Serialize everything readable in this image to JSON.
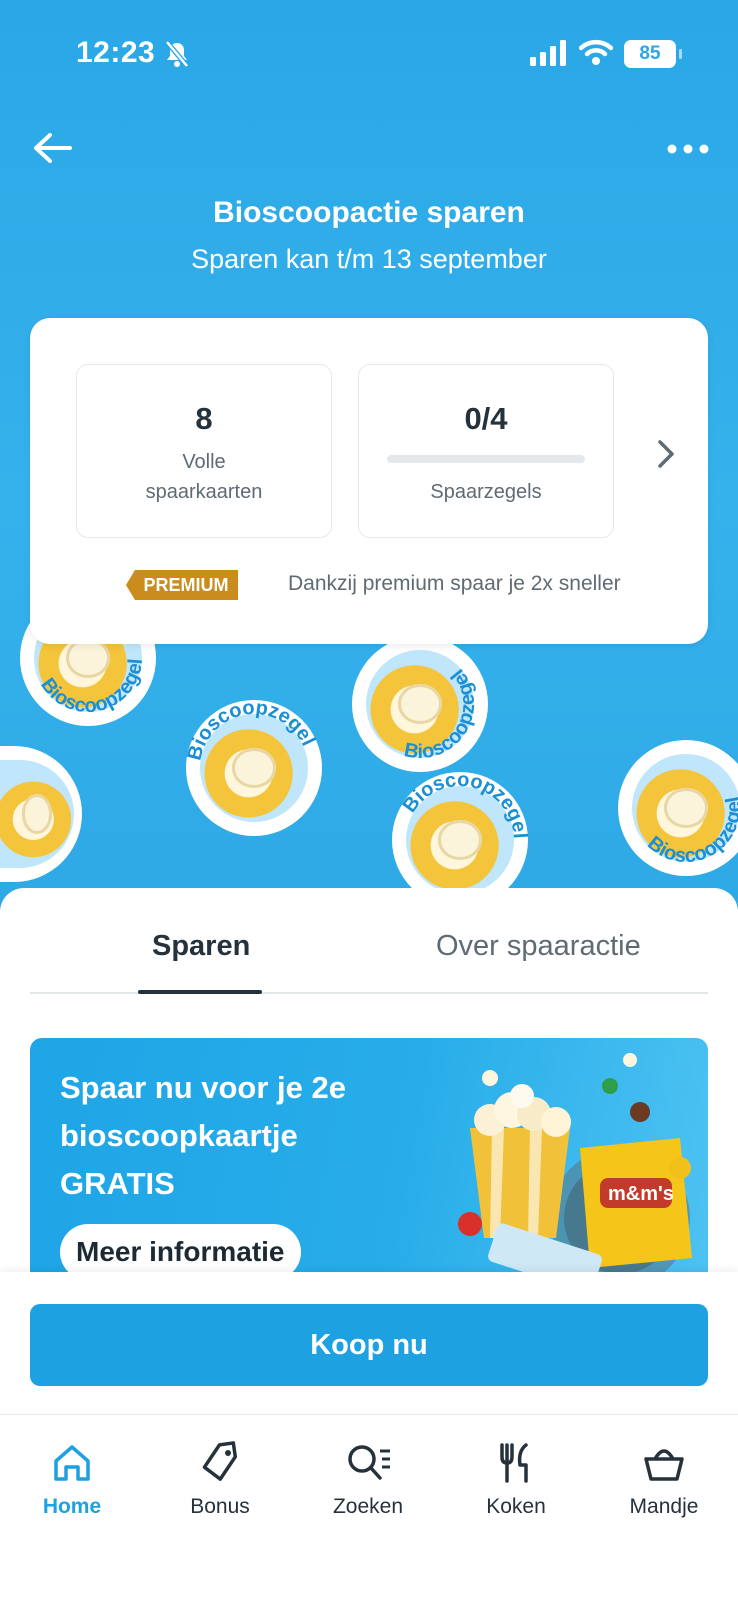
{
  "status_bar": {
    "time": "12:23",
    "battery": "85"
  },
  "header": {
    "title": "Bioscoopactie sparen",
    "subtitle": "Sparen kan t/m 13 september"
  },
  "savings": {
    "full_cards_value": "8",
    "full_cards_label_line1": "Volle",
    "full_cards_label_line2": "spaarkaarten",
    "stamps_value": "0/4",
    "stamps_progress": 0,
    "stamps_label": "Spaarzegels",
    "premium_badge": "PREMIUM",
    "premium_text": "Dankzij premium spaar je 2x sneller"
  },
  "stamp_ring_text": "Bioscoopzegel",
  "tabs": [
    {
      "label": "Sparen",
      "active": true
    },
    {
      "label": "Over spaaractie",
      "active": false
    }
  ],
  "promo": {
    "title": "Spaar nu voor je 2e bioscoopkaartje GRATIS",
    "button": "Meer informatie"
  },
  "buy_button": "Koop nu",
  "nav": [
    {
      "label": "Home",
      "icon": "home-icon",
      "active": true
    },
    {
      "label": "Bonus",
      "icon": "bonus-tag-icon",
      "active": false
    },
    {
      "label": "Zoeken",
      "icon": "search-list-icon",
      "active": false
    },
    {
      "label": "Koken",
      "icon": "cutlery-icon",
      "active": false
    },
    {
      "label": "Mandje",
      "icon": "basket-icon",
      "active": false
    }
  ],
  "colors": {
    "hero_blue": "#2aa7e6",
    "brand_blue": "#1ea1e1",
    "premium_gold": "#c98c1d",
    "text_dark": "#25323b"
  }
}
